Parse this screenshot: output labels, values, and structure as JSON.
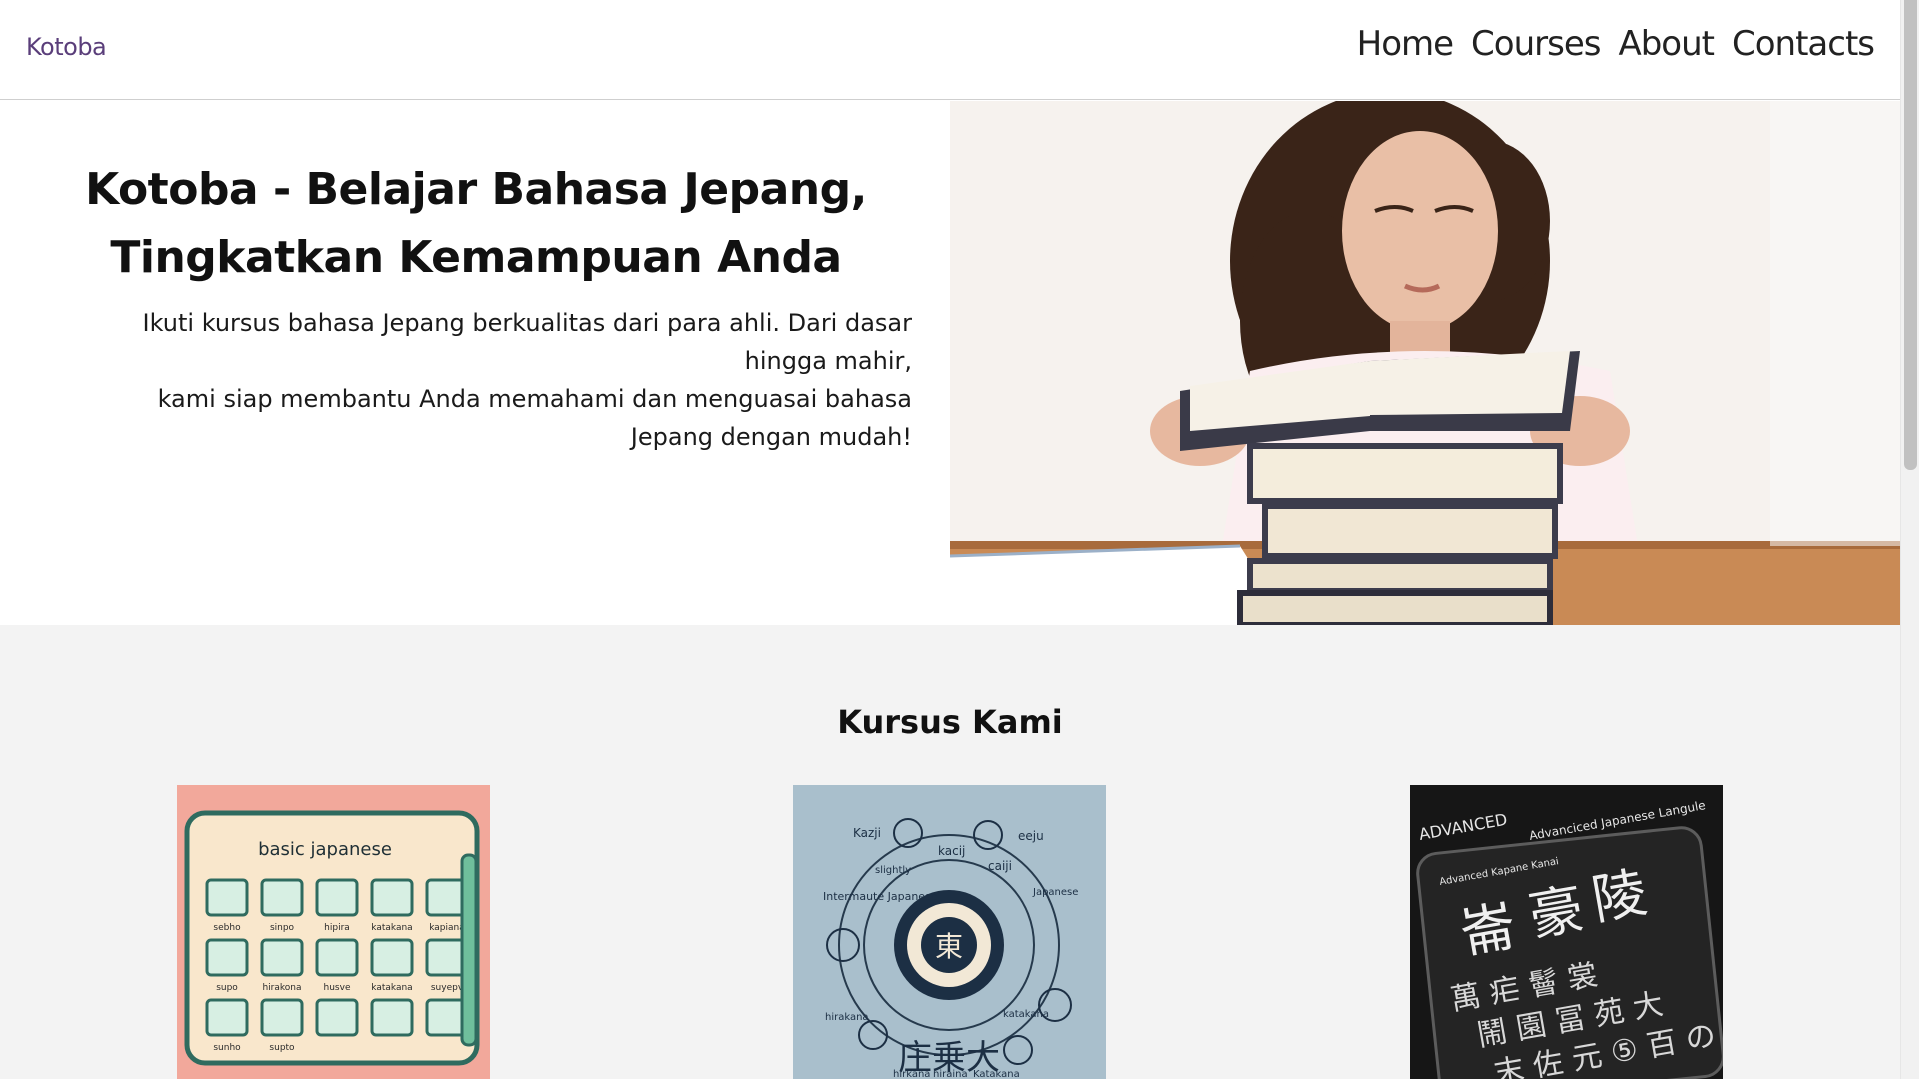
{
  "navbar": {
    "brand": "Kotoba",
    "links": [
      "Home",
      "Courses",
      "About",
      "Contacts"
    ]
  },
  "hero": {
    "title_line1": "Kotoba - Belajar Bahasa Jepang,",
    "title_line2": "Tingkatkan Kemampuan Anda",
    "desc_line1": "Ikuti kursus bahasa Jepang berkualitas dari para ahli. Dari dasar",
    "desc_line2": "hingga mahir,",
    "desc_line3": "kami siap membantu Anda memahami dan menguasai bahasa",
    "desc_line4": "Jepang dengan mudah!"
  },
  "courses": {
    "title": "Kursus Kami",
    "cards": [
      {
        "image_text": "basic japanese",
        "labels": [
          "sebho",
          "sinpo",
          "hipira",
          "katakana",
          "kapiana",
          "supo",
          "hirakona",
          "husve",
          "katakana",
          "suyepv",
          "sunho",
          "supto"
        ]
      },
      {
        "image_text_1": "Kazji",
        "image_text_2": "kacij",
        "image_text_3": "eeju",
        "image_text_4": "caiji",
        "image_text_5": "Intermaute Japanese",
        "image_text_6": "Japanese",
        "image_text_7": "hirakana",
        "image_text_8": "katakana",
        "image_text_9": "hirkana",
        "image_text_10": "hiraina",
        "image_text_11": "Katakana",
        "image_text_12": "slightly"
      },
      {
        "image_text_1": "ADVANCED",
        "image_text_2": "Advanciced Japanese Langule",
        "image_text_3": "Advanced Kapane Kanai"
      }
    ]
  },
  "colors": {
    "brand": "#5a3e7a",
    "hero_bg": "#ffffff",
    "courses_bg": "#f3f3f3"
  }
}
